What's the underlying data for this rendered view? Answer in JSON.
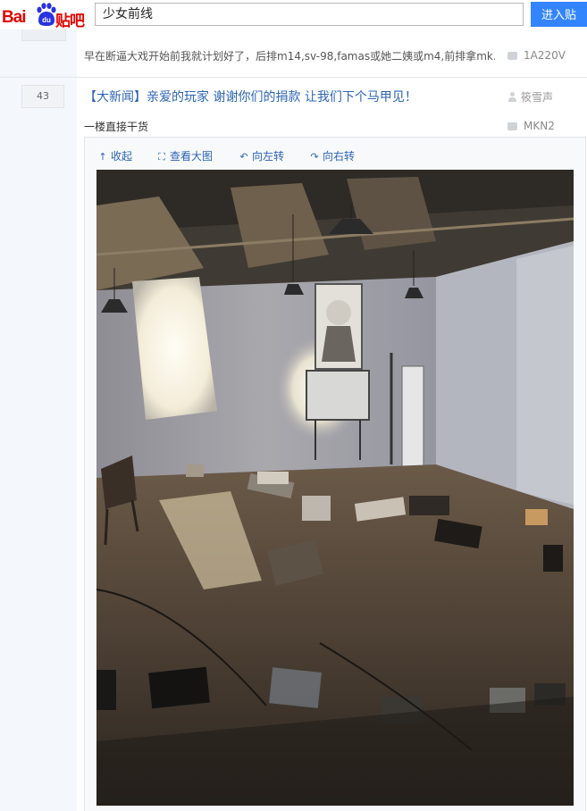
{
  "header": {
    "logo_text_latin": "Bai",
    "logo_text_du": "du",
    "logo_text_cn": "贴吧",
    "search_value": "少女前线",
    "enter_button": "进入贴吧"
  },
  "previous_thread": {
    "abstract": "早在断逼大戏开始前我就计划好了，后排m14,sv-98,famas或她二姨或m4,前排拿mk...",
    "last_reply": "1A220V"
  },
  "thread": {
    "reply_count": "43",
    "title": "【大新闻】亲爱的玩家 谢谢你们的捐款 让我们下个马甲见！",
    "author": "筱雪声",
    "abstract": "一楼直接干货",
    "last_reply": "MKN2"
  },
  "media_toolbar": {
    "collapse": "收起",
    "view_large": "查看大图",
    "rotate_left": "向左转",
    "rotate_right": "向右转"
  },
  "colors": {
    "brand_red": "#e10602",
    "brand_blue": "#3385ff",
    "link_blue": "#2d64b3"
  },
  "icons": [
    "baidu-paw-icon",
    "bubble-icon",
    "user-icon",
    "collapse-arrow-icon",
    "expand-icon",
    "rotate-left-icon",
    "rotate-right-icon"
  ]
}
